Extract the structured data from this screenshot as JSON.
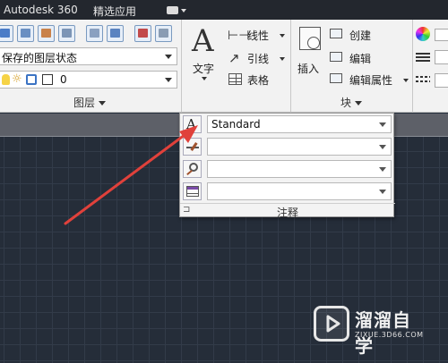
{
  "titlebar": {
    "app_name": "Autodesk 360",
    "featured_apps": "精选应用"
  },
  "layers_panel": {
    "state_dropdown": "保存的图层状态",
    "layer_value": "0",
    "title": "图层"
  },
  "annotation_panel": {
    "text_label": "文字",
    "linear_label": "线性",
    "leader_label": "引线",
    "table_label": "表格"
  },
  "block_panel": {
    "insert_label": "插入",
    "create_label": "创建",
    "edit_label": "编辑",
    "edit_attributes_label": "编辑属性",
    "title": "块"
  },
  "annotation_dropdown": {
    "text_style_value": "Standard",
    "footer_title": "注释"
  },
  "colors": {
    "arrow": "#e0413b",
    "accent": "#7a9ac0"
  },
  "watermark": {
    "title": "溜溜自学",
    "url": "ZIXUE.3D66.COM"
  }
}
